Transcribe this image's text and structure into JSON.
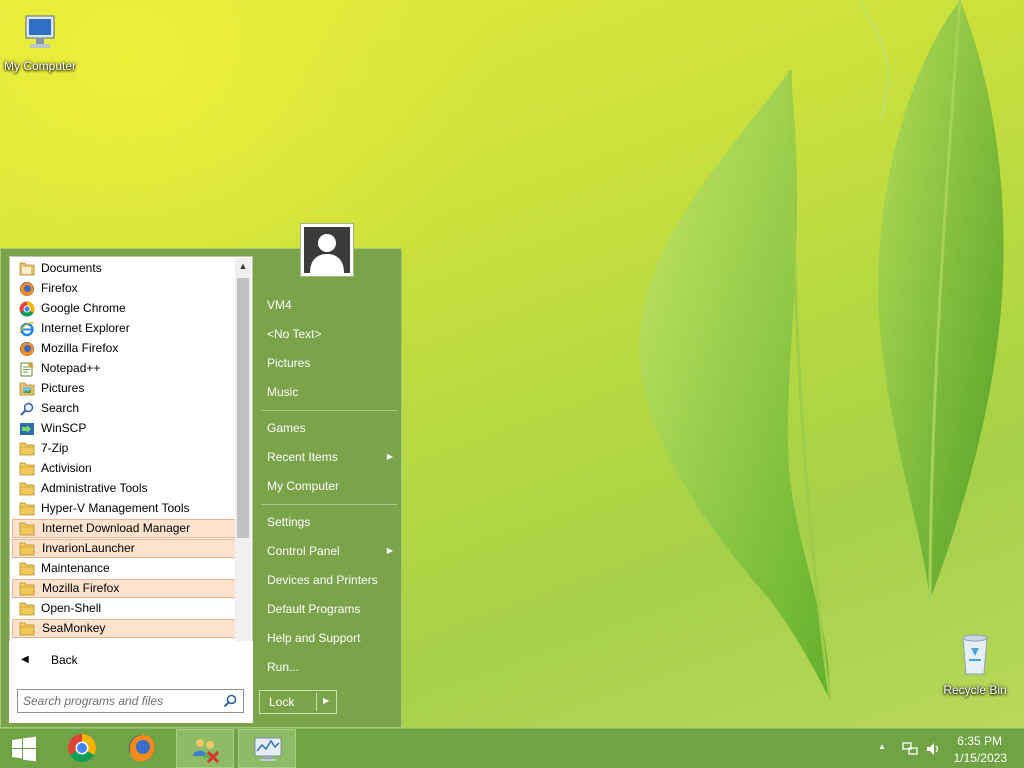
{
  "desktop": {
    "icons": [
      {
        "label": "My Computer"
      },
      {
        "label": "Recycle Bin"
      }
    ]
  },
  "start_menu": {
    "programs": [
      {
        "label": "Documents",
        "icon": "documents-folder-icon",
        "highlighted": false
      },
      {
        "label": "Firefox",
        "icon": "firefox-icon",
        "highlighted": false
      },
      {
        "label": "Google Chrome",
        "icon": "chrome-icon",
        "highlighted": false
      },
      {
        "label": "Internet Explorer",
        "icon": "ie-icon",
        "highlighted": false
      },
      {
        "label": "Mozilla Firefox",
        "icon": "firefox-icon",
        "highlighted": false
      },
      {
        "label": "Notepad++",
        "icon": "notepad-icon",
        "highlighted": false
      },
      {
        "label": "Pictures",
        "icon": "pictures-icon",
        "highlighted": false
      },
      {
        "label": "Search",
        "icon": "search-icon",
        "highlighted": false
      },
      {
        "label": "WinSCP",
        "icon": "winscp-icon",
        "highlighted": false
      },
      {
        "label": "7-Zip",
        "icon": "folder-icon",
        "highlighted": false
      },
      {
        "label": "Activision",
        "icon": "folder-icon",
        "highlighted": false
      },
      {
        "label": "Administrative Tools",
        "icon": "folder-icon",
        "highlighted": false
      },
      {
        "label": "Hyper-V Management Tools",
        "icon": "folder-icon",
        "highlighted": false
      },
      {
        "label": "Internet Download Manager",
        "icon": "folder-icon",
        "highlighted": true
      },
      {
        "label": "InvarionLauncher",
        "icon": "folder-icon",
        "highlighted": true
      },
      {
        "label": "Maintenance",
        "icon": "folder-icon",
        "highlighted": false
      },
      {
        "label": "Mozilla Firefox",
        "icon": "folder-icon",
        "highlighted": true
      },
      {
        "label": "Open-Shell",
        "icon": "folder-icon",
        "highlighted": false
      },
      {
        "label": "SeaMonkey",
        "icon": "folder-icon",
        "highlighted": true
      }
    ],
    "back_label": "Back",
    "search_placeholder": "Search programs and files",
    "right_items": [
      {
        "label": "VM4",
        "submenu": false
      },
      {
        "label": "<No Text>",
        "submenu": false
      },
      {
        "label": "Pictures",
        "submenu": false
      },
      {
        "label": "Music",
        "submenu": false
      },
      {
        "label": "Games",
        "submenu": false
      },
      {
        "label": "Recent Items",
        "submenu": true
      },
      {
        "label": "My Computer",
        "submenu": false
      },
      {
        "label": "Settings",
        "submenu": false
      },
      {
        "label": "Control Panel",
        "submenu": true
      },
      {
        "label": "Devices and Printers",
        "submenu": false
      },
      {
        "label": "Default Programs",
        "submenu": false
      },
      {
        "label": "Help and Support",
        "submenu": false
      },
      {
        "label": "Run...",
        "submenu": false
      }
    ],
    "lock_label": "Lock"
  },
  "taskbar": {
    "buttons": [
      {
        "name": "start-button",
        "icon": "windows-logo-icon",
        "active": false
      },
      {
        "name": "chrome-taskbar-button",
        "icon": "chrome-icon",
        "active": false
      },
      {
        "name": "firefox-taskbar-button",
        "icon": "firefox-icon",
        "active": false
      },
      {
        "name": "network-app-taskbar-button",
        "icon": "network-users-icon",
        "active": true
      },
      {
        "name": "monitor-app-taskbar-button",
        "icon": "system-monitor-icon",
        "active": true
      }
    ],
    "time": "6:35 PM",
    "date": "1/15/2023"
  },
  "colors": {
    "menu_green": "#7aa34a",
    "taskbar_green": "#6fa344",
    "highlight_fill": "#fde3cd",
    "highlight_border": "#f0b58c"
  }
}
